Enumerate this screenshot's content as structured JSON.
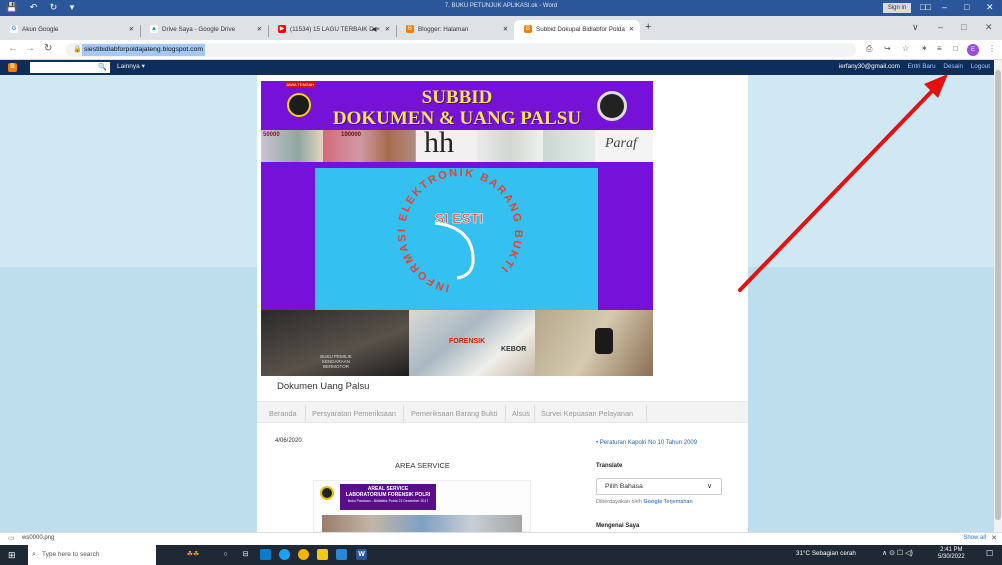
{
  "word": {
    "title": "7. BUKU PETUNJUK APLIKASI.ok  -  Word",
    "quick_access": "💾 ↶ ↻ ▾",
    "sign_in": "Sign in",
    "ribbon_icon": "□□",
    "minimize": "–",
    "restore": "□",
    "close": "✕"
  },
  "browser": {
    "tabs": [
      {
        "label": "Akun Google",
        "icon": "G",
        "icon_color": "#ffffff",
        "icon_text_color": "#4285f4"
      },
      {
        "label": "Drive Saya - Google Drive",
        "icon": "▲",
        "icon_color": "#ffffff",
        "icon_text_color": "#0f9d58"
      },
      {
        "label": "(11534) 15 LAGU TERBAIK D",
        "icon": "▶",
        "icon_color": "#ff0000",
        "icon_text_color": "#ffffff"
      },
      {
        "label": "Blogger: Halaman",
        "icon": "B",
        "icon_color": "#f57d00",
        "icon_text_color": "#ffffff"
      },
      {
        "label": "Subbid Dokupal Bidlabfor Polda",
        "icon": "B",
        "icon_color": "#f57d00",
        "icon_text_color": "#ffffff"
      }
    ],
    "tab_close": "✕",
    "audio_icon": "◀×",
    "new_tab": "+",
    "tabs_dropdown": "∨",
    "win_min": "–",
    "win_max": "□",
    "win_close": "✕",
    "back": "←",
    "forward": "→",
    "reload": "↻",
    "url": "siestibidlabforpoldajateng.blogspot.com",
    "lock": "🔒",
    "ext_icons": [
      "⎙",
      "↪",
      "☆",
      "✶",
      "≡",
      "□"
    ],
    "profile_letter": "E",
    "menu": "⋮"
  },
  "blogger_nav": {
    "logo": "B",
    "search_icon": "🔍",
    "more": "Lainnya ▾",
    "email": "ierfany30@gmail.com",
    "new_post": "Entri Baru",
    "design": "Desain",
    "logout": "Logout"
  },
  "header": {
    "line1": "SUBBID",
    "line2": "DOKUMEN & UANG PALSU",
    "badge_label": "JAWA TENGAH",
    "esti_letters": "SI ESTI",
    "ring_text": "INFORMASI ELEKTRONIK BARANG BUKTI",
    "money_text": "50000",
    "money_text_2": "100000",
    "signature": "Paraf"
  },
  "photos": {
    "kendaraan_label": "BUKU PEMILIK KENDARAAN BERMOTOR",
    "bag_label": "FORENSIK",
    "bag_label_2": "KEBOR"
  },
  "blog_title": "Dokumen Uang Palsu",
  "page_tabs": [
    "Beranda",
    "Persyaratan Pemeriksaan",
    "Pemeriksaan Barang Bukti",
    "Alsus",
    "Survei Kepuasan Pelayanan"
  ],
  "post": {
    "date": "4/06/2020",
    "title": "AREA SERVICE",
    "poster_line1": "AREAL SERVICE",
    "poster_line2": "LABORATORIUM FORENSIK POLRI",
    "poster_line3": "Buku Panduan - Bidlabfor Polda 21 Desember 2017"
  },
  "sidebar": {
    "link1": "Peraturan Kapolri No 10 Tahun 2009",
    "translate_title": "Translate",
    "select_value": "Pilih Bahasa",
    "select_arrow": "∨",
    "powered_prefix": "Diberdayakan oleh",
    "powered_google": "Google",
    "powered_suffix": "Terjemahan",
    "about_title": "Mengenai Saya"
  },
  "downloads": {
    "file": "ws0000.png",
    "show_all": "Show all",
    "close": "✕"
  },
  "taskbar": {
    "start": "⊞",
    "search_placeholder": "Type here to search",
    "search_icon": "⌕",
    "weather": "31°C  Sebagian cerah",
    "tray": "∧  ⊙  ☐  ◁)",
    "time": "2:41 PM",
    "date": "5/30/2022",
    "notifications": "☐"
  },
  "colors": {
    "annotation_arrow": "#e41010",
    "header_purple": "#7612d8",
    "header_cyan": "#35c0f2",
    "title_yellow": "#f7e25a"
  }
}
